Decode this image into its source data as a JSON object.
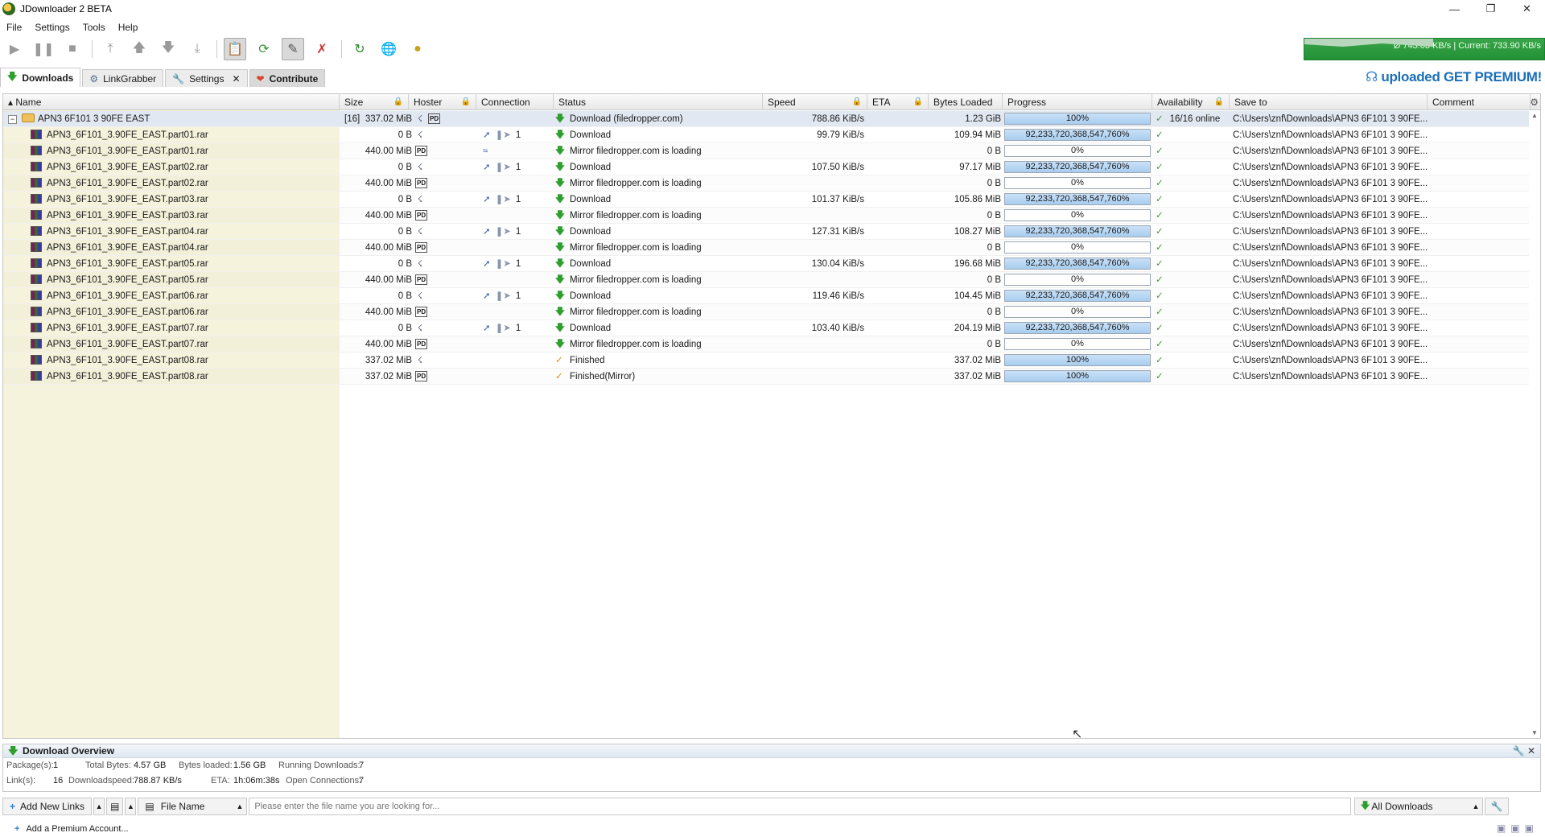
{
  "window": {
    "title": "JDownloader 2 BETA"
  },
  "menu": [
    "File",
    "Settings",
    "Tools",
    "Help"
  ],
  "speed_meter": {
    "text": "Ø 743.63 KB/s | Current: 733.90 KB/s"
  },
  "tabs": [
    {
      "label": "Downloads",
      "icon": "download-arrow-icon",
      "active": true
    },
    {
      "label": "LinkGrabber",
      "icon": "linkgrabber-icon"
    },
    {
      "label": "Settings",
      "icon": "wrench-icon",
      "closable": true
    },
    {
      "label": "Contribute",
      "icon": "heart-icon"
    }
  ],
  "premium_banner": {
    "brand": "uploaded",
    "cta": "GET PREMIUM!"
  },
  "columns": [
    "Name",
    "Size",
    "Hoster",
    "Connection",
    "Status",
    "Speed",
    "ETA",
    "Bytes Loaded",
    "Progress",
    "Availability",
    "Save to",
    "Comment"
  ],
  "package": {
    "name": "APN3 6F101 3 90FE EAST",
    "count": "[16]",
    "size": "337.02 MiB",
    "status": "Download (filedropper.com)",
    "speed": "788.86 KiB/s",
    "bytes": "1.23 GiB",
    "progress_text": "100%",
    "progress_fraction": 1.0,
    "availability": "16/16 online",
    "save_to": "C:\\Users\\znf\\Downloads\\APN3 6F101 3 90FE..."
  },
  "rows": [
    {
      "name": "APN3_6F101_3.90FE_EAST.part01.rar",
      "size": "0 B",
      "hoster": "filedropper",
      "conn": "1",
      "status": "Download",
      "status_type": "dl",
      "speed": "99.79 KiB/s",
      "bytes": "109.94 MiB",
      "progress_text": "92,233,720,368,547,760%",
      "progress_fraction": 1.0,
      "save_to": "C:\\Users\\znf\\Downloads\\APN3 6F101 3 90FE..."
    },
    {
      "name": "APN3_6F101_3.90FE_EAST.part01.rar",
      "size": "440.00 MiB",
      "hoster": "PD",
      "conn": "",
      "status": "Mirror filedropper.com is loading",
      "status_type": "dl",
      "speed": "",
      "bytes": "0 B",
      "progress_text": "0%",
      "progress_fraction": 0,
      "save_to": "C:\\Users\\znf\\Downloads\\APN3 6F101 3 90FE..."
    },
    {
      "name": "APN3_6F101_3.90FE_EAST.part02.rar",
      "size": "0 B",
      "hoster": "filedropper",
      "conn": "1",
      "status": "Download",
      "status_type": "dl",
      "speed": "107.50 KiB/s",
      "bytes": "97.17 MiB",
      "progress_text": "92,233,720,368,547,760%",
      "progress_fraction": 1.0,
      "save_to": "C:\\Users\\znf\\Downloads\\APN3 6F101 3 90FE..."
    },
    {
      "name": "APN3_6F101_3.90FE_EAST.part02.rar",
      "size": "440.00 MiB",
      "hoster": "PD",
      "conn": "",
      "status": "Mirror filedropper.com is loading",
      "status_type": "dl",
      "speed": "",
      "bytes": "0 B",
      "progress_text": "0%",
      "progress_fraction": 0,
      "save_to": "C:\\Users\\znf\\Downloads\\APN3 6F101 3 90FE..."
    },
    {
      "name": "APN3_6F101_3.90FE_EAST.part03.rar",
      "size": "0 B",
      "hoster": "filedropper",
      "conn": "1",
      "status": "Download",
      "status_type": "dl",
      "speed": "101.37 KiB/s",
      "bytes": "105.86 MiB",
      "progress_text": "92,233,720,368,547,760%",
      "progress_fraction": 1.0,
      "save_to": "C:\\Users\\znf\\Downloads\\APN3 6F101 3 90FE..."
    },
    {
      "name": "APN3_6F101_3.90FE_EAST.part03.rar",
      "size": "440.00 MiB",
      "hoster": "PD",
      "conn": "",
      "status": "Mirror filedropper.com is loading",
      "status_type": "dl",
      "speed": "",
      "bytes": "0 B",
      "progress_text": "0%",
      "progress_fraction": 0,
      "save_to": "C:\\Users\\znf\\Downloads\\APN3 6F101 3 90FE..."
    },
    {
      "name": "APN3_6F101_3.90FE_EAST.part04.rar",
      "size": "0 B",
      "hoster": "filedropper",
      "conn": "1",
      "status": "Download",
      "status_type": "dl",
      "speed": "127.31 KiB/s",
      "bytes": "108.27 MiB",
      "progress_text": "92,233,720,368,547,760%",
      "progress_fraction": 1.0,
      "save_to": "C:\\Users\\znf\\Downloads\\APN3 6F101 3 90FE..."
    },
    {
      "name": "APN3_6F101_3.90FE_EAST.part04.rar",
      "size": "440.00 MiB",
      "hoster": "PD",
      "conn": "",
      "status": "Mirror filedropper.com is loading",
      "status_type": "dl",
      "speed": "",
      "bytes": "0 B",
      "progress_text": "0%",
      "progress_fraction": 0,
      "save_to": "C:\\Users\\znf\\Downloads\\APN3 6F101 3 90FE..."
    },
    {
      "name": "APN3_6F101_3.90FE_EAST.part05.rar",
      "size": "0 B",
      "hoster": "filedropper",
      "conn": "1",
      "status": "Download",
      "status_type": "dl",
      "speed": "130.04 KiB/s",
      "bytes": "196.68 MiB",
      "progress_text": "92,233,720,368,547,760%",
      "progress_fraction": 1.0,
      "save_to": "C:\\Users\\znf\\Downloads\\APN3 6F101 3 90FE..."
    },
    {
      "name": "APN3_6F101_3.90FE_EAST.part05.rar",
      "size": "440.00 MiB",
      "hoster": "PD",
      "conn": "",
      "status": "Mirror filedropper.com is loading",
      "status_type": "dl",
      "speed": "",
      "bytes": "0 B",
      "progress_text": "0%",
      "progress_fraction": 0,
      "save_to": "C:\\Users\\znf\\Downloads\\APN3 6F101 3 90FE..."
    },
    {
      "name": "APN3_6F101_3.90FE_EAST.part06.rar",
      "size": "0 B",
      "hoster": "filedropper",
      "conn": "1",
      "status": "Download",
      "status_type": "dl",
      "speed": "119.46 KiB/s",
      "bytes": "104.45 MiB",
      "progress_text": "92,233,720,368,547,760%",
      "progress_fraction": 1.0,
      "save_to": "C:\\Users\\znf\\Downloads\\APN3 6F101 3 90FE..."
    },
    {
      "name": "APN3_6F101_3.90FE_EAST.part06.rar",
      "size": "440.00 MiB",
      "hoster": "PD",
      "conn": "",
      "status": "Mirror filedropper.com is loading",
      "status_type": "dl",
      "speed": "",
      "bytes": "0 B",
      "progress_text": "0%",
      "progress_fraction": 0,
      "save_to": "C:\\Users\\znf\\Downloads\\APN3 6F101 3 90FE..."
    },
    {
      "name": "APN3_6F101_3.90FE_EAST.part07.rar",
      "size": "0 B",
      "hoster": "filedropper",
      "conn": "1",
      "status": "Download",
      "status_type": "dl",
      "speed": "103.40 KiB/s",
      "bytes": "204.19 MiB",
      "progress_text": "92,233,720,368,547,760%",
      "progress_fraction": 1.0,
      "save_to": "C:\\Users\\znf\\Downloads\\APN3 6F101 3 90FE..."
    },
    {
      "name": "APN3_6F101_3.90FE_EAST.part07.rar",
      "size": "440.00 MiB",
      "hoster": "PD",
      "conn": "",
      "status": "Mirror filedropper.com is loading",
      "status_type": "dl",
      "speed": "",
      "bytes": "0 B",
      "progress_text": "0%",
      "progress_fraction": 0,
      "save_to": "C:\\Users\\znf\\Downloads\\APN3 6F101 3 90FE..."
    },
    {
      "name": "APN3_6F101_3.90FE_EAST.part08.rar",
      "size": "337.02 MiB",
      "hoster": "filedropper",
      "conn": "",
      "status": "Finished",
      "status_type": "fin",
      "speed": "",
      "bytes": "337.02 MiB",
      "progress_text": "100%",
      "progress_fraction": 1.0,
      "save_to": "C:\\Users\\znf\\Downloads\\APN3 6F101 3 90FE..."
    },
    {
      "name": "APN3_6F101_3.90FE_EAST.part08.rar",
      "size": "337.02 MiB",
      "hoster": "PD",
      "conn": "",
      "status": "Finished(Mirror)",
      "status_type": "fin",
      "speed": "",
      "bytes": "337.02 MiB",
      "progress_text": "100%",
      "progress_fraction": 1.0,
      "save_to": "C:\\Users\\znf\\Downloads\\APN3 6F101 3 90FE..."
    }
  ],
  "overview": {
    "title": "Download Overview",
    "packages_label": "Package(s):",
    "packages": "1",
    "total_bytes_label": "Total Bytes:",
    "total_bytes": "4.57 GB",
    "bytes_loaded_label": "Bytes loaded:",
    "bytes_loaded": "1.56 GB",
    "running_label": "Running Downloads:",
    "running": "7",
    "links_label": "Link(s):",
    "links": "16",
    "speed_label": "Downloadspeed:",
    "speed": "788.87 KB/s",
    "eta_label": "ETA:",
    "eta": "1h:06m:38s",
    "connections_label": "Open Connections:",
    "connections": "7"
  },
  "bottombar": {
    "add_links": "Add New Links",
    "sort_field": "File Name",
    "search_placeholder": "Please enter the file name you are looking for...",
    "filter": "All Downloads"
  },
  "statusbar": {
    "add_premium": "Add a Premium Account..."
  }
}
